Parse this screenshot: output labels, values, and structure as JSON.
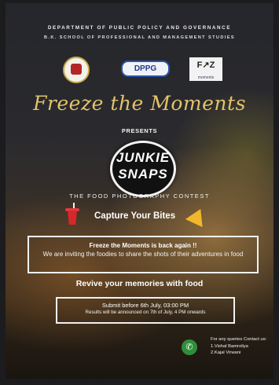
{
  "header": {
    "department": "DEPARTMENT OF PUBLIC POLICY AND GOVERNANCE",
    "school": "B.K. SCHOOL OF PROFESSIONAL AND MANAGEMENT STUDIES"
  },
  "logos": {
    "dppg": "DPPG",
    "ftm": "F↗Z",
    "ftm_sub": "moments"
  },
  "title": "Freeze the Moments",
  "presents": "PRESENTS",
  "badge": {
    "line1": "JUNKIE",
    "line2": "SNAPS"
  },
  "contest": "THE FOOD PHOTOGRAPHY CONTEST",
  "tagline": "Capture Your Bites",
  "announce": {
    "headline": "Freeze the Moments is back again !!",
    "body": "We are inviting the foodies to share the shots of their adventures in food"
  },
  "revive": "Revive your memories with food",
  "deadline": {
    "submit": "Submit before 6th July, 03:00 PM",
    "results": "Results will be announced on 7th of July, 4 PM onwards"
  },
  "contact": {
    "heading": "For any queries Contact us:",
    "person1": "1.Vishal Bamroliya",
    "person2": "2.Kajal Virwani"
  },
  "icons": [
    "seal-logo-icon",
    "dppg-logo-icon",
    "ftm-logo-icon",
    "soft-drink-icon",
    "cheese-icon",
    "phone-icon"
  ],
  "colors": {
    "title_gold": "#e2c36a",
    "badge_bg": "#111111",
    "phone_green": "#2f8e3a",
    "cup_red": "#d8262d",
    "cheese_yellow": "#f1b82b"
  }
}
